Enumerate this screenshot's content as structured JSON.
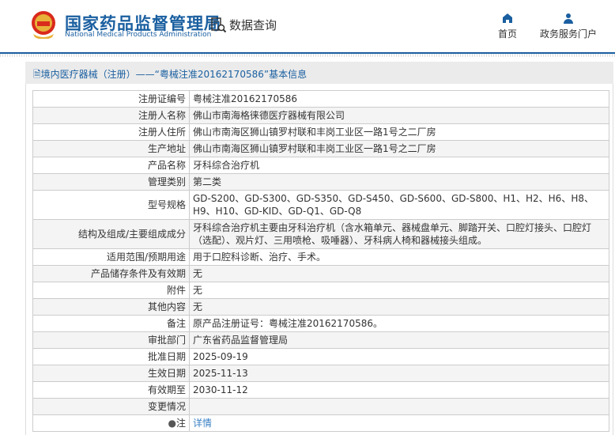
{
  "header": {
    "logo_cn": "国家药品监督管理局",
    "logo_en": "National Medical Products Administration",
    "query": "数据查询",
    "nav": [
      {
        "label": "首页",
        "icon": "home-icon"
      },
      {
        "label": "政务服务门户",
        "icon": "user-icon"
      }
    ]
  },
  "breadcrumb": "境内医疗器械（注册）——“粤械注准20162170586”基本信息",
  "rows": [
    {
      "k": "注册证编号",
      "v": "粤械注准20162170586"
    },
    {
      "k": "注册人名称",
      "v": "佛山市南海格徕德医疗器械有限公司"
    },
    {
      "k": "注册人住所",
      "v": "佛山市南海区狮山镇罗村联和丰岗工业区一路1号之二厂房"
    },
    {
      "k": "生产地址",
      "v": "佛山市南海区狮山镇罗村联和丰岗工业区一路1号之二厂房"
    },
    {
      "k": "产品名称",
      "v": "牙科综合治疗机"
    },
    {
      "k": "管理类别",
      "v": "第二类"
    },
    {
      "k": "型号规格",
      "v": "GD-S200、GD-S300、GD-S350、GD-S450、GD-S600、GD-S800、H1、H2、H6、H8、H9、H10、GD-KID、GD-Q1、GD-Q8"
    },
    {
      "k": "结构及组成/主要组成成分",
      "v": "牙科综合治疗机主要由牙科治疗机（含水箱单元、器械盘单元、脚踏开关、口腔灯接头、口腔灯（选配）、观片灯、三用喷枪、吸唾器）、牙科病人椅和器械接头组成。"
    },
    {
      "k": "适用范围/预期用途",
      "v": "用于口腔科诊断、治疗、手术。"
    },
    {
      "k": "产品储存条件及有效期",
      "v": "无"
    },
    {
      "k": "附件",
      "v": "无"
    },
    {
      "k": "其他内容",
      "v": "无"
    },
    {
      "k": "备注",
      "v": "原产品注册证号：粤械注准20162170586。"
    },
    {
      "k": "审批部门",
      "v": "广东省药品监督管理局"
    },
    {
      "k": "批准日期",
      "v": "2025-09-19"
    },
    {
      "k": "生效日期",
      "v": "2025-11-13"
    },
    {
      "k": "有效期至",
      "v": "2030-11-12"
    },
    {
      "k": "变更情况",
      "v": ""
    }
  ],
  "note": {
    "k": "注",
    "v": "详情"
  },
  "colors": {
    "brand": "#1a5fa0",
    "link": "#3b82c4"
  }
}
